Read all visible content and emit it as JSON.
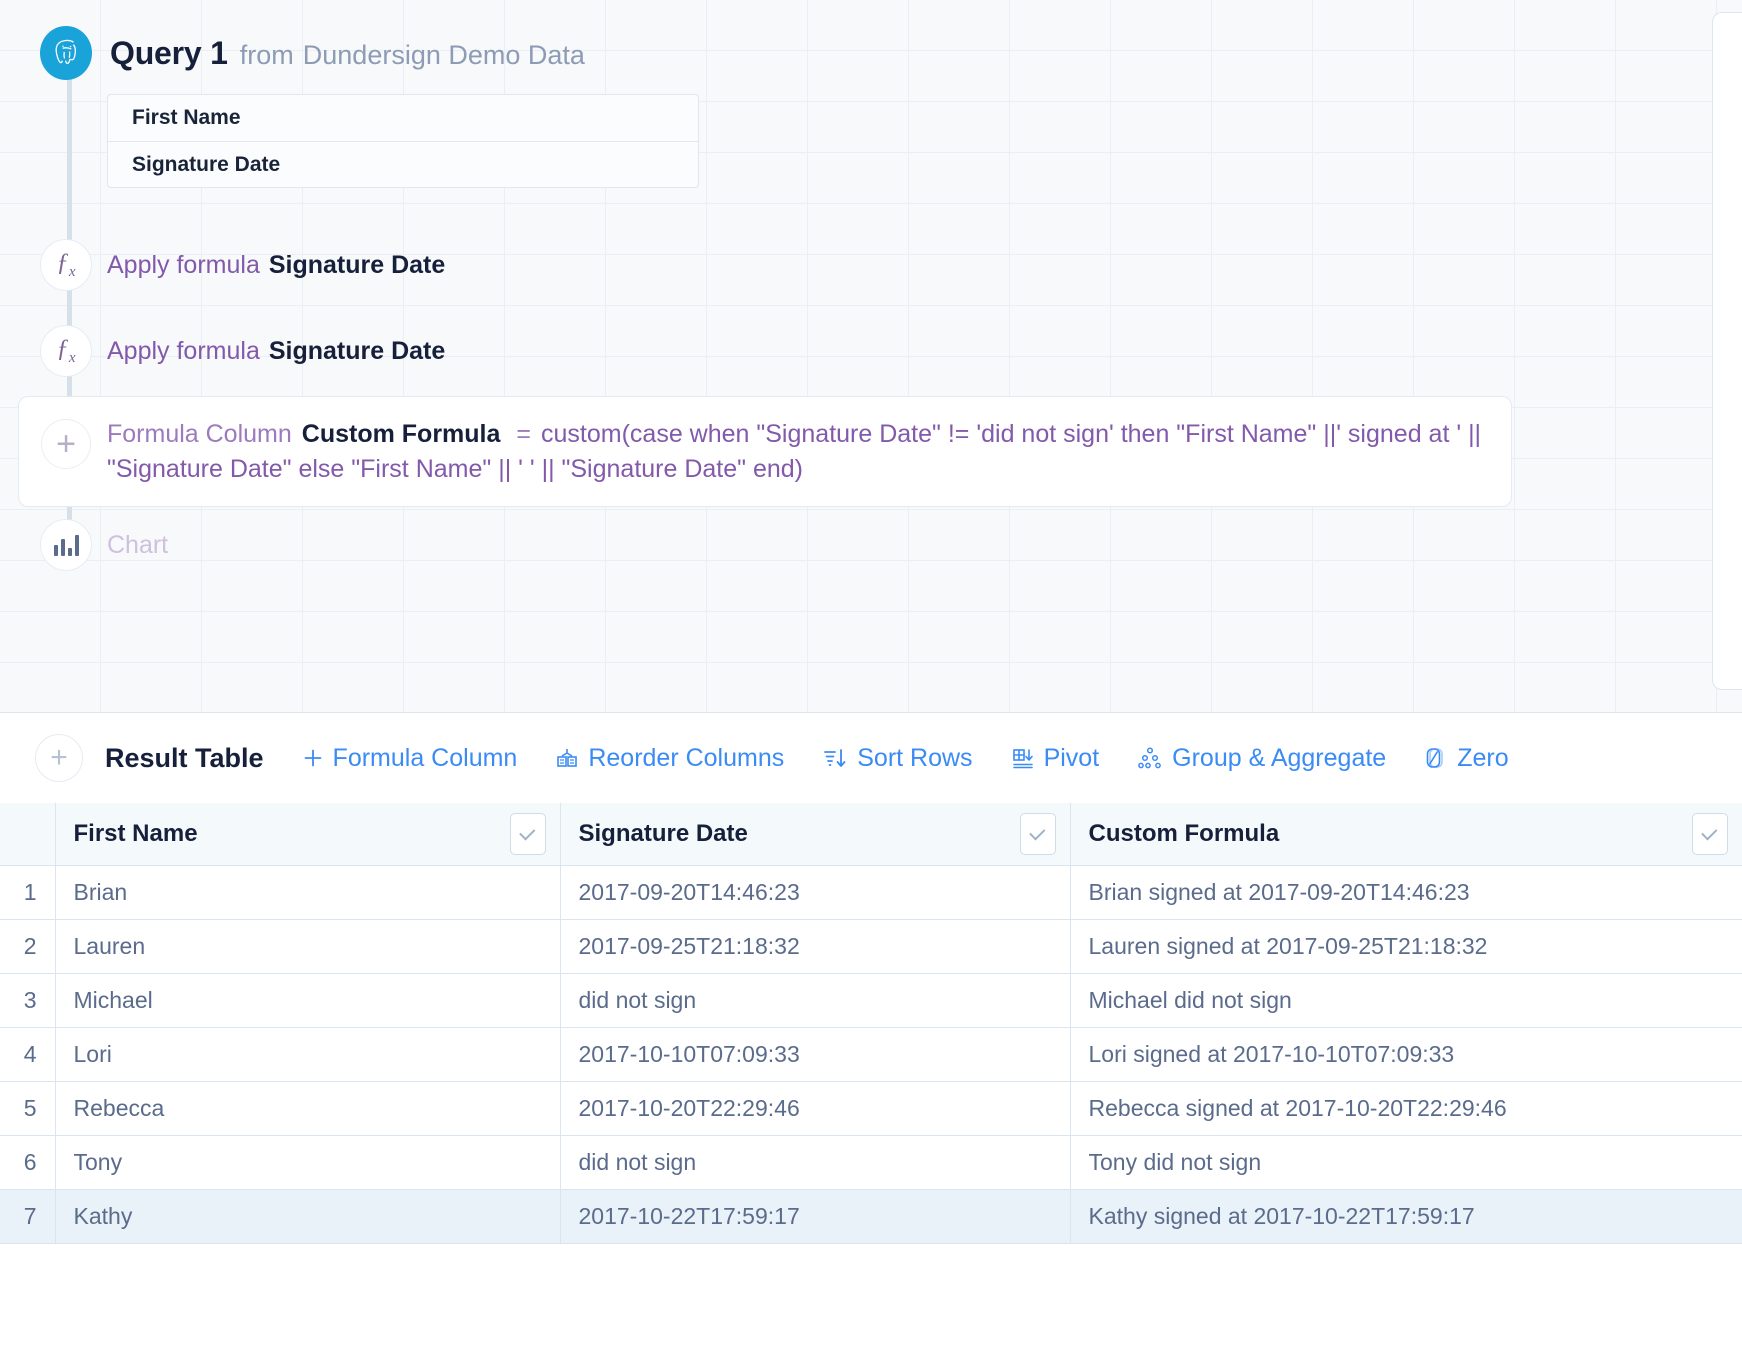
{
  "pipeline": {
    "query": {
      "icon": "postgres-elephant-icon",
      "title": "Query 1",
      "from_label": "from",
      "source": "Dundersign Demo Data"
    },
    "columns": [
      {
        "label": "First Name"
      },
      {
        "label": "Signature Date"
      }
    ],
    "steps": [
      {
        "icon": "fx-icon",
        "action": "Apply formula",
        "target": "Signature Date"
      },
      {
        "icon": "fx-icon",
        "action": "Apply formula",
        "target": "Signature Date"
      }
    ],
    "formula_card": {
      "add_icon": "plus-icon",
      "label": "Formula Column",
      "name": "Custom Formula",
      "equals": "=",
      "expression": "custom(case when \"Signature Date\" != 'did not sign' then \"First Name\" ||' signed at ' || \"Signature Date\" else \"First Name\" || ' ' || \"Signature Date\" end)"
    },
    "chart_step": {
      "icon": "bar-chart-icon",
      "label": "Chart"
    }
  },
  "result": {
    "add_icon": "plus-icon",
    "title": "Result Table",
    "tools": [
      {
        "icon": "plus-icon",
        "label": "Formula Column"
      },
      {
        "icon": "reorder-columns-icon",
        "label": "Reorder Columns"
      },
      {
        "icon": "sort-rows-icon",
        "label": "Sort Rows"
      },
      {
        "icon": "pivot-icon",
        "label": "Pivot"
      },
      {
        "icon": "group-aggregate-icon",
        "label": "Group & Aggregate"
      },
      {
        "icon": "zero-icon",
        "label": "Zero"
      }
    ],
    "table": {
      "headers": [
        {
          "label": "First Name",
          "caret": "chevron-down-icon"
        },
        {
          "label": "Signature Date",
          "caret": "chevron-down-icon"
        },
        {
          "label": "Custom Formula",
          "caret": "chevron-down-icon"
        }
      ],
      "rows": [
        {
          "n": "1",
          "first_name": "Brian",
          "signature_date": "2017-09-20T14:46:23",
          "custom_formula": "Brian signed at 2017-09-20T14:46:23",
          "highlight": false
        },
        {
          "n": "2",
          "first_name": "Lauren",
          "signature_date": "2017-09-25T21:18:32",
          "custom_formula": "Lauren signed at 2017-09-25T21:18:32",
          "highlight": false
        },
        {
          "n": "3",
          "first_name": "Michael",
          "signature_date": "did not sign",
          "custom_formula": "Michael did not sign",
          "highlight": false
        },
        {
          "n": "4",
          "first_name": "Lori",
          "signature_date": "2017-10-10T07:09:33",
          "custom_formula": "Lori signed at 2017-10-10T07:09:33",
          "highlight": false
        },
        {
          "n": "5",
          "first_name": "Rebecca",
          "signature_date": "2017-10-20T22:29:46",
          "custom_formula": "Rebecca signed at 2017-10-20T22:29:46",
          "highlight": false
        },
        {
          "n": "6",
          "first_name": "Tony",
          "signature_date": "did not sign",
          "custom_formula": "Tony did not sign",
          "highlight": false
        },
        {
          "n": "7",
          "first_name": "Kathy",
          "signature_date": "2017-10-22T17:59:17",
          "custom_formula": "Kathy signed at 2017-10-22T17:59:17",
          "highlight": true
        }
      ]
    }
  },
  "colors": {
    "accent_blue": "#3b8bf5",
    "purple": "#8259ab",
    "postgres_blue": "#1aa3d8",
    "text_dark": "#17203a",
    "text_muted": "#5a6b8c",
    "row_highlight": "#e9f2f8"
  }
}
